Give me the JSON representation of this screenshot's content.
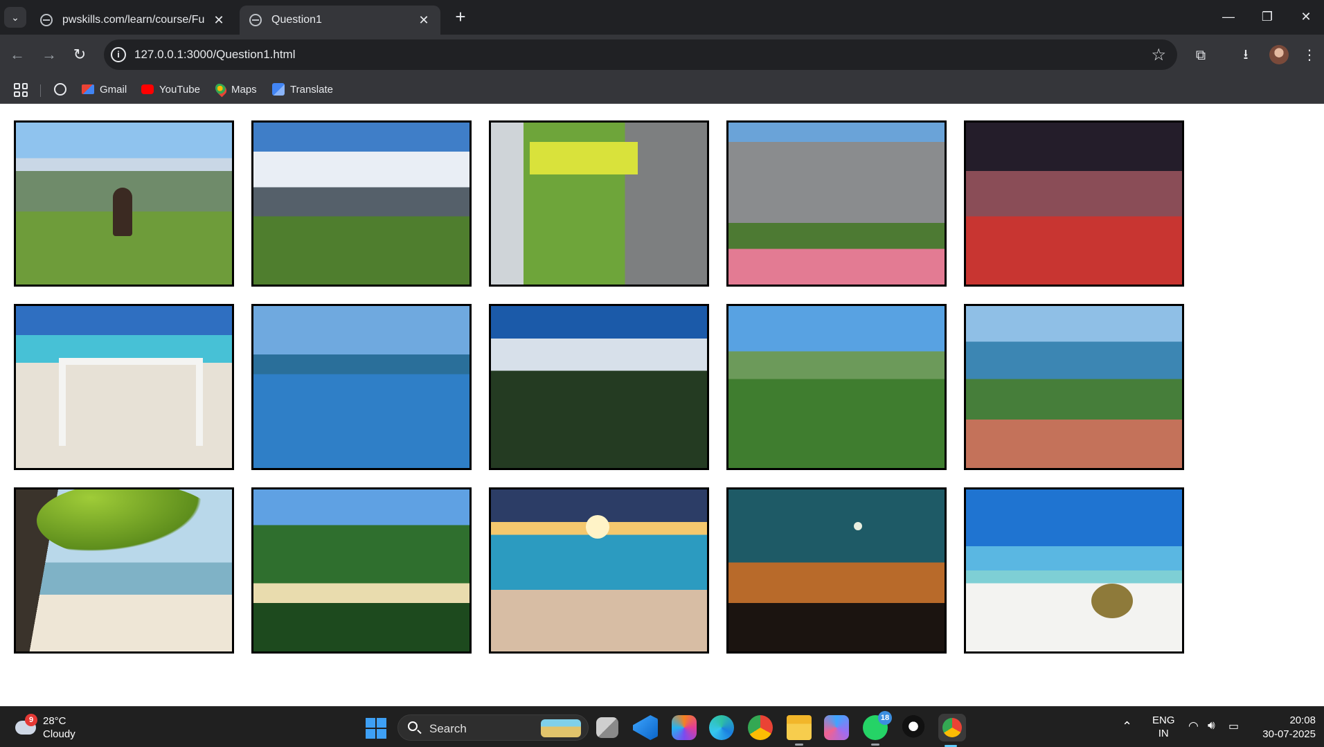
{
  "browser": {
    "tabs": [
      {
        "title": "pwskills.com/learn/course/Full-",
        "close": "✕"
      },
      {
        "title": "Question1",
        "close": "✕"
      }
    ],
    "new_tab": "+",
    "window_controls": {
      "minimize": "—",
      "restore": "❐",
      "close": "✕"
    },
    "url": "127.0.0.1:3000/Question1.html",
    "nav": {
      "back": "←",
      "forward": "→",
      "reload": "↻"
    },
    "bookmarks": [
      "Gmail",
      "YouTube",
      "Maps",
      "Translate"
    ]
  },
  "gallery": {
    "images": [
      {
        "subject": "woman-on-bench-mountain-valley"
      },
      {
        "subject": "glacier-mountain-forest"
      },
      {
        "subject": "food-truck-street"
      },
      {
        "subject": "stone-house-flowers"
      },
      {
        "subject": "night-market-dining"
      },
      {
        "subject": "beach-chairs"
      },
      {
        "subject": "infinity-pool-tropical"
      },
      {
        "subject": "glacier-through-trees"
      },
      {
        "subject": "coastal-hiking-trail"
      },
      {
        "subject": "resort-stairs-sea-view"
      },
      {
        "subject": "palm-tree-beach-swing"
      },
      {
        "subject": "bay-beach-forest"
      },
      {
        "subject": "sunset-waves"
      },
      {
        "subject": "moon-over-mountains"
      },
      {
        "subject": "coconut-on-beach"
      }
    ]
  },
  "taskbar": {
    "weather": {
      "badge": "9",
      "temp": "28°C",
      "condition": "Cloudy"
    },
    "search_label": "Search",
    "whatsapp_badge": "18",
    "language": {
      "line1": "ENG",
      "line2": "IN"
    },
    "clock": {
      "time": "20:08",
      "date": "30-07-2025"
    }
  }
}
